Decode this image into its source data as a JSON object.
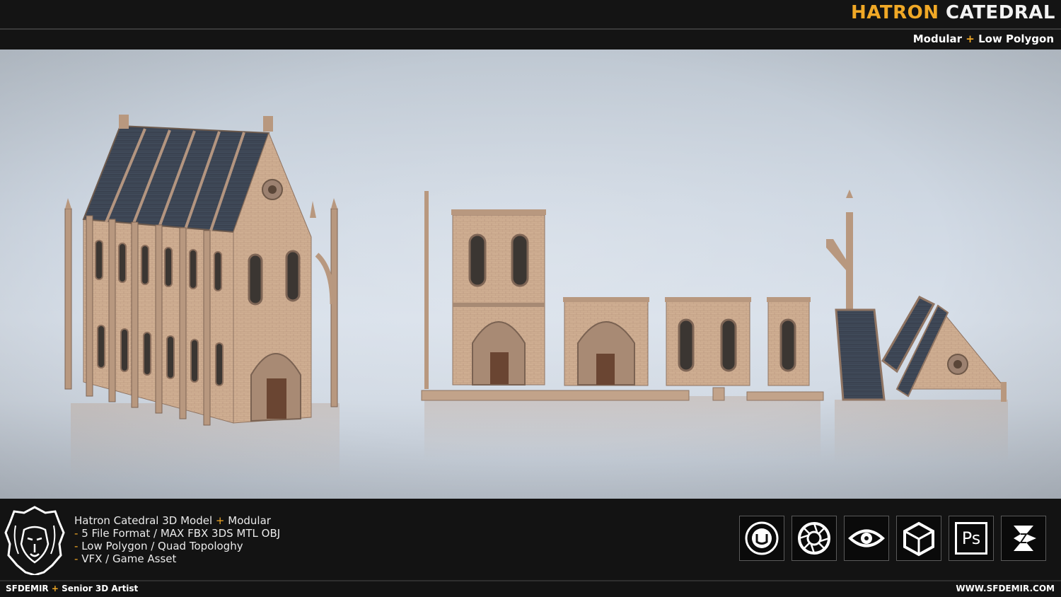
{
  "header": {
    "title_part1": "HATRON",
    "title_part2": "CATEDRAL",
    "subtitle_part1": "Modular",
    "subtitle_plus": "+",
    "subtitle_part2": "Low Polygon"
  },
  "description": {
    "line1_a": "Hatron Catedral 3D Model",
    "line1_plus": "+",
    "line1_b": "Modular",
    "bullet": "-",
    "line2": "5 File Format / MAX FBX 3DS MTL OBJ",
    "line3": "Low Polygon / Quad Topologhy",
    "line4": "VFX / Game Asset"
  },
  "software_icons": [
    "unreal-engine-icon",
    "keyshot-icon",
    "eye-viewer-icon",
    "unity-icon",
    "photoshop-icon",
    "3ds-max-icon"
  ],
  "photoshop_label": "Ps",
  "footer": {
    "author": "SFDEMIR",
    "plus": "+",
    "role": "Senior 3D Artist",
    "website": "WWW.SFDEMIR.COM"
  },
  "colors": {
    "accent": "#f0a826",
    "stone": "#c9a98e",
    "roof": "#3c4654",
    "background": "#d3dbe5"
  }
}
